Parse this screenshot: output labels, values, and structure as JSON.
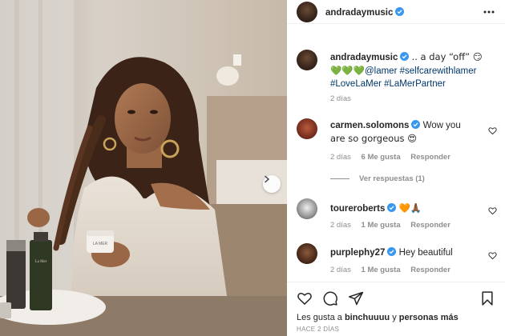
{
  "post": {
    "author": "andradaymusic",
    "caption_author": "andradaymusic",
    "caption_text": ".. a day “off” 😏",
    "caption_hearts": "💚💚💚",
    "caption_tags_line1": "@lamer #selfcarewithlamer",
    "caption_tags_line2": "#LoveLaMer #LaMerPartner",
    "caption_time": "2 días"
  },
  "photo": {
    "jar_label": "LA MER",
    "bottle_label": "La Mer"
  },
  "comments": [
    {
      "user": "carmen.solomons",
      "text_line1": "Wow you",
      "text_line2": "are so gorgeous 😍",
      "time": "2 días",
      "likes": "6 Me gusta",
      "reply": "Responder"
    },
    {
      "user": "toureroberts",
      "text": "🧡🙏🏾",
      "time": "2 días",
      "likes": "1 Me gusta",
      "reply": "Responder"
    },
    {
      "user": "purplephy27",
      "text": "Hey beautiful",
      "time": "2 días",
      "likes": "1 Me gusta",
      "reply": "Responder"
    }
  ],
  "view_replies": "Ver respuestas (1)",
  "likes_summary": {
    "prefix": "Les gusta a ",
    "user": "binchuuuu",
    "middle": " y ",
    "rest": "personas más"
  },
  "post_time": "HACE 2 DÍAS",
  "colors": {
    "verified": "#3897f0",
    "link": "#00376b",
    "muted": "#8e8e8e"
  }
}
